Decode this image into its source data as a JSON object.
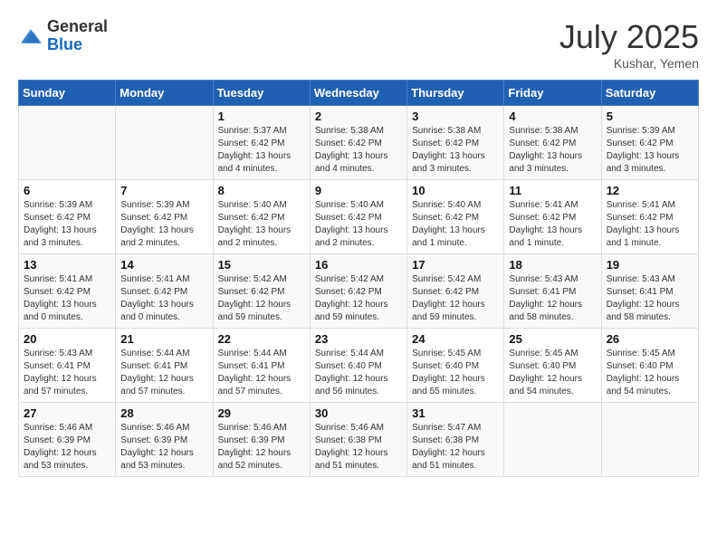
{
  "header": {
    "logo_general": "General",
    "logo_blue": "Blue",
    "month_title": "July 2025",
    "subtitle": "Kushar, Yemen"
  },
  "days_of_week": [
    "Sunday",
    "Monday",
    "Tuesday",
    "Wednesday",
    "Thursday",
    "Friday",
    "Saturday"
  ],
  "weeks": [
    [
      {
        "day": "",
        "info": ""
      },
      {
        "day": "",
        "info": ""
      },
      {
        "day": "1",
        "info": "Sunrise: 5:37 AM\nSunset: 6:42 PM\nDaylight: 13 hours and 4 minutes."
      },
      {
        "day": "2",
        "info": "Sunrise: 5:38 AM\nSunset: 6:42 PM\nDaylight: 13 hours and 4 minutes."
      },
      {
        "day": "3",
        "info": "Sunrise: 5:38 AM\nSunset: 6:42 PM\nDaylight: 13 hours and 3 minutes."
      },
      {
        "day": "4",
        "info": "Sunrise: 5:38 AM\nSunset: 6:42 PM\nDaylight: 13 hours and 3 minutes."
      },
      {
        "day": "5",
        "info": "Sunrise: 5:39 AM\nSunset: 6:42 PM\nDaylight: 13 hours and 3 minutes."
      }
    ],
    [
      {
        "day": "6",
        "info": "Sunrise: 5:39 AM\nSunset: 6:42 PM\nDaylight: 13 hours and 3 minutes."
      },
      {
        "day": "7",
        "info": "Sunrise: 5:39 AM\nSunset: 6:42 PM\nDaylight: 13 hours and 2 minutes."
      },
      {
        "day": "8",
        "info": "Sunrise: 5:40 AM\nSunset: 6:42 PM\nDaylight: 13 hours and 2 minutes."
      },
      {
        "day": "9",
        "info": "Sunrise: 5:40 AM\nSunset: 6:42 PM\nDaylight: 13 hours and 2 minutes."
      },
      {
        "day": "10",
        "info": "Sunrise: 5:40 AM\nSunset: 6:42 PM\nDaylight: 13 hours and 1 minute."
      },
      {
        "day": "11",
        "info": "Sunrise: 5:41 AM\nSunset: 6:42 PM\nDaylight: 13 hours and 1 minute."
      },
      {
        "day": "12",
        "info": "Sunrise: 5:41 AM\nSunset: 6:42 PM\nDaylight: 13 hours and 1 minute."
      }
    ],
    [
      {
        "day": "13",
        "info": "Sunrise: 5:41 AM\nSunset: 6:42 PM\nDaylight: 13 hours and 0 minutes."
      },
      {
        "day": "14",
        "info": "Sunrise: 5:41 AM\nSunset: 6:42 PM\nDaylight: 13 hours and 0 minutes."
      },
      {
        "day": "15",
        "info": "Sunrise: 5:42 AM\nSunset: 6:42 PM\nDaylight: 12 hours and 59 minutes."
      },
      {
        "day": "16",
        "info": "Sunrise: 5:42 AM\nSunset: 6:42 PM\nDaylight: 12 hours and 59 minutes."
      },
      {
        "day": "17",
        "info": "Sunrise: 5:42 AM\nSunset: 6:42 PM\nDaylight: 12 hours and 59 minutes."
      },
      {
        "day": "18",
        "info": "Sunrise: 5:43 AM\nSunset: 6:41 PM\nDaylight: 12 hours and 58 minutes."
      },
      {
        "day": "19",
        "info": "Sunrise: 5:43 AM\nSunset: 6:41 PM\nDaylight: 12 hours and 58 minutes."
      }
    ],
    [
      {
        "day": "20",
        "info": "Sunrise: 5:43 AM\nSunset: 6:41 PM\nDaylight: 12 hours and 57 minutes."
      },
      {
        "day": "21",
        "info": "Sunrise: 5:44 AM\nSunset: 6:41 PM\nDaylight: 12 hours and 57 minutes."
      },
      {
        "day": "22",
        "info": "Sunrise: 5:44 AM\nSunset: 6:41 PM\nDaylight: 12 hours and 57 minutes."
      },
      {
        "day": "23",
        "info": "Sunrise: 5:44 AM\nSunset: 6:40 PM\nDaylight: 12 hours and 56 minutes."
      },
      {
        "day": "24",
        "info": "Sunrise: 5:45 AM\nSunset: 6:40 PM\nDaylight: 12 hours and 55 minutes."
      },
      {
        "day": "25",
        "info": "Sunrise: 5:45 AM\nSunset: 6:40 PM\nDaylight: 12 hours and 54 minutes."
      },
      {
        "day": "26",
        "info": "Sunrise: 5:45 AM\nSunset: 6:40 PM\nDaylight: 12 hours and 54 minutes."
      }
    ],
    [
      {
        "day": "27",
        "info": "Sunrise: 5:46 AM\nSunset: 6:39 PM\nDaylight: 12 hours and 53 minutes."
      },
      {
        "day": "28",
        "info": "Sunrise: 5:46 AM\nSunset: 6:39 PM\nDaylight: 12 hours and 53 minutes."
      },
      {
        "day": "29",
        "info": "Sunrise: 5:46 AM\nSunset: 6:39 PM\nDaylight: 12 hours and 52 minutes."
      },
      {
        "day": "30",
        "info": "Sunrise: 5:46 AM\nSunset: 6:38 PM\nDaylight: 12 hours and 51 minutes."
      },
      {
        "day": "31",
        "info": "Sunrise: 5:47 AM\nSunset: 6:38 PM\nDaylight: 12 hours and 51 minutes."
      },
      {
        "day": "",
        "info": ""
      },
      {
        "day": "",
        "info": ""
      }
    ]
  ]
}
